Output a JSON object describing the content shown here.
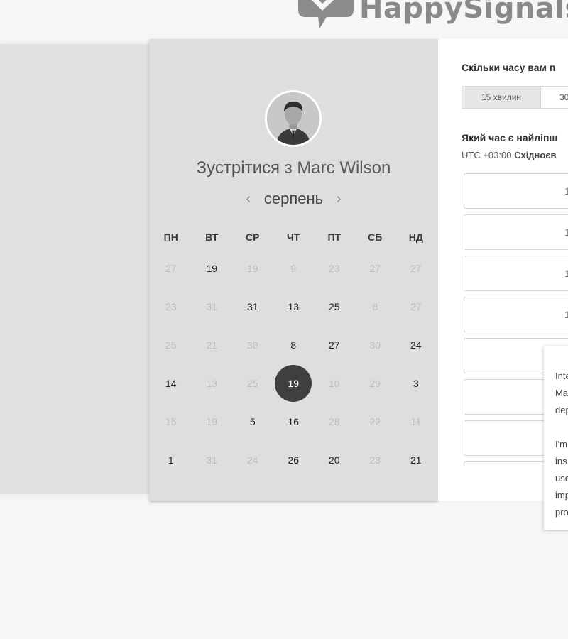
{
  "brand": {
    "name": "HappySignals",
    "logo_icon": "speech-bubble-check-icon"
  },
  "calendar": {
    "host_photo": "host-avatar",
    "title_prefix": "Зустрітися з",
    "host_name": "Marc Wilson",
    "month": "серпень",
    "prev_icon": "chevron-left-icon",
    "next_icon": "chevron-right-icon",
    "weekdays": [
      "ПН",
      "ВТ",
      "СР",
      "ЧТ",
      "ПТ",
      "СБ",
      "НД"
    ],
    "weeks": [
      [
        {
          "d": "27",
          "a": false
        },
        {
          "d": "19",
          "a": true
        },
        {
          "d": "19",
          "a": false
        },
        {
          "d": "9",
          "a": false
        },
        {
          "d": "23",
          "a": false
        },
        {
          "d": "27",
          "a": false
        },
        {
          "d": "27",
          "a": false
        }
      ],
      [
        {
          "d": "23",
          "a": false
        },
        {
          "d": "31",
          "a": false
        },
        {
          "d": "31",
          "a": true
        },
        {
          "d": "13",
          "a": true
        },
        {
          "d": "25",
          "a": true
        },
        {
          "d": "8",
          "a": false
        },
        {
          "d": "27",
          "a": false
        }
      ],
      [
        {
          "d": "25",
          "a": false
        },
        {
          "d": "21",
          "a": false
        },
        {
          "d": "30",
          "a": false
        },
        {
          "d": "8",
          "a": true
        },
        {
          "d": "27",
          "a": true
        },
        {
          "d": "30",
          "a": false
        },
        {
          "d": "24",
          "a": true
        }
      ],
      [
        {
          "d": "14",
          "a": true
        },
        {
          "d": "13",
          "a": false
        },
        {
          "d": "25",
          "a": false
        },
        {
          "d": "19",
          "a": true,
          "sel": true
        },
        {
          "d": "10",
          "a": false
        },
        {
          "d": "29",
          "a": false
        },
        {
          "d": "3",
          "a": true
        }
      ],
      [
        {
          "d": "15",
          "a": false
        },
        {
          "d": "19",
          "a": false
        },
        {
          "d": "5",
          "a": true
        },
        {
          "d": "16",
          "a": true
        },
        {
          "d": "28",
          "a": false
        },
        {
          "d": "22",
          "a": false
        },
        {
          "d": "11",
          "a": false
        }
      ],
      [
        {
          "d": "1",
          "a": true
        },
        {
          "d": "31",
          "a": false
        },
        {
          "d": "24",
          "a": false
        },
        {
          "d": "26",
          "a": true
        },
        {
          "d": "20",
          "a": true
        },
        {
          "d": "23",
          "a": false
        },
        {
          "d": "21",
          "a": true
        }
      ]
    ]
  },
  "booking": {
    "duration_question": "Скільки часу вам п",
    "durations": [
      "15 хвилин",
      "30"
    ],
    "time_question": "Який час є найліпш",
    "tz_offset": "UTC +03:00",
    "tz_name": "Східноєв",
    "slots": [
      "1",
      "1",
      "1",
      "1",
      "",
      "",
      "",
      ""
    ]
  },
  "popover": {
    "lines": [
      "Inte",
      "Ma",
      "dep",
      "",
      "I'm",
      "ins",
      "use",
      "imp",
      "pro"
    ]
  }
}
